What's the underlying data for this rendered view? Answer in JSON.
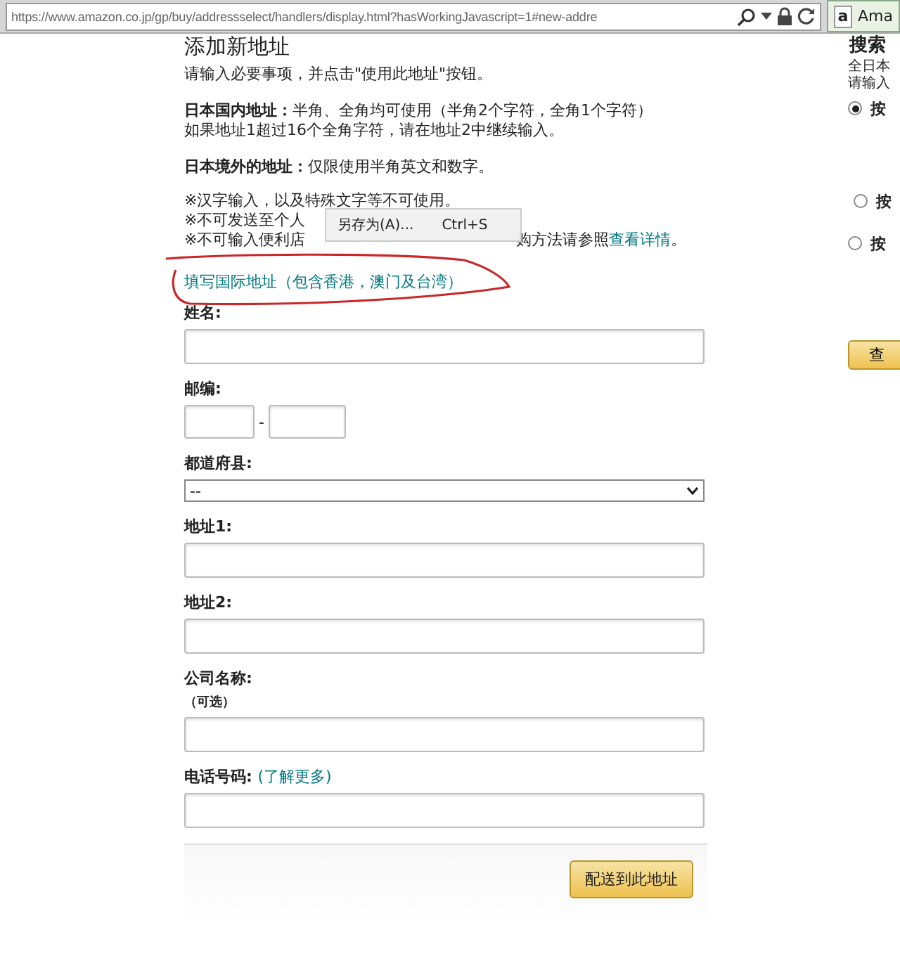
{
  "browser": {
    "url": "https://www.amazon.co.jp/gp/buy/addressselect/handlers/display.html?hasWorkingJavascript=1#new-addre",
    "tab_icon": "a",
    "tab_title": "Ama"
  },
  "page": {
    "title": "添加新地址",
    "intro": "请输入必要事项，并点击\"使用此地址\"按钮。",
    "notes": [
      {
        "lines": [
          "**日本国内地址：**半角、全角均可使用（半角2个字符，全角1个字符）",
          "如果地址1超过16个全角字符，请在地址2中继续输入。"
        ]
      },
      {
        "lines": [
          "**日本境外的地址：**仅限使用半角英文和数字。"
        ]
      }
    ],
    "warnings": [
      {
        "before": "※汉字输入，以及特殊文字等不可使用。"
      },
      {
        "before": "※不可发送至个人"
      },
      {
        "before": "※不可输入便利店",
        "after": "购方法请参照",
        "link": "查看详情",
        "end": "。"
      }
    ],
    "context_menu": {
      "label": "另存为(A)...",
      "shortcut": "Ctrl+S"
    },
    "intl_link": "填写国际地址（包含香港，澳门及台湾）",
    "fields": [
      {
        "kind": "text",
        "label": "姓名:"
      },
      {
        "kind": "postal",
        "label": "邮编:",
        "separator": "-"
      },
      {
        "kind": "select",
        "label": "都道府县:",
        "value": "--"
      },
      {
        "kind": "text",
        "label": "地址1:"
      },
      {
        "kind": "text",
        "label": "地址2:"
      },
      {
        "kind": "text",
        "label": "公司名称:",
        "note": "（可选）"
      },
      {
        "kind": "text",
        "label": "电话号码:",
        "link": "(了解更多)"
      }
    ],
    "submit": "配送到此地址"
  },
  "side": {
    "heading": "搜索",
    "lines": [
      "全日本",
      "请输入"
    ],
    "options": [
      {
        "label": "按",
        "selected": true
      },
      {
        "label": "按",
        "selected": false
      },
      {
        "label": "按",
        "selected": false
      }
    ],
    "button": "查"
  }
}
